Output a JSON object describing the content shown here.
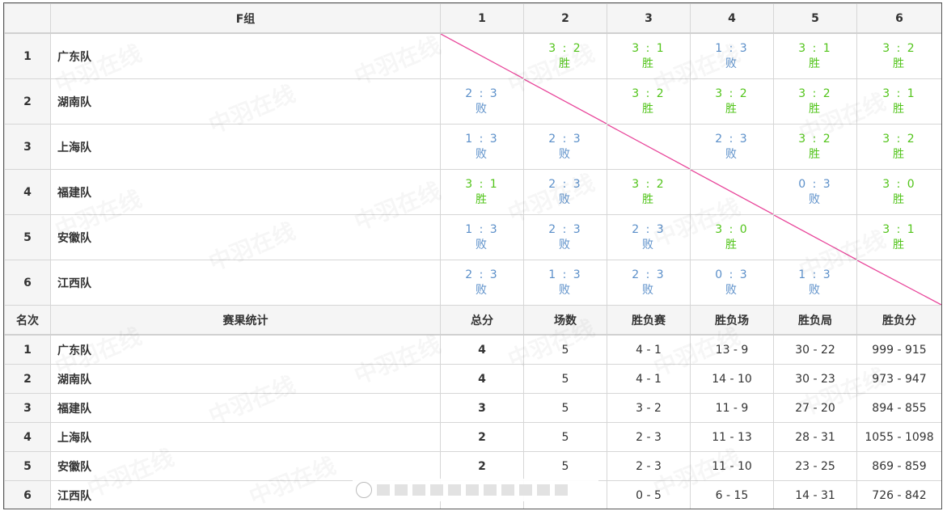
{
  "group_title": "F组",
  "columns": [
    "1",
    "2",
    "3",
    "4",
    "5",
    "6"
  ],
  "matrix": [
    {
      "rank": "1",
      "team": "广东队",
      "cells": [
        null,
        {
          "score": "3 : 2",
          "result": "胜",
          "win": true
        },
        {
          "score": "3 : 1",
          "result": "胜",
          "win": true
        },
        {
          "score": "1 : 3",
          "result": "败",
          "win": false
        },
        {
          "score": "3 : 1",
          "result": "胜",
          "win": true
        },
        {
          "score": "3 : 2",
          "result": "胜",
          "win": true
        }
      ]
    },
    {
      "rank": "2",
      "team": "湖南队",
      "cells": [
        {
          "score": "2 : 3",
          "result": "败",
          "win": false
        },
        null,
        {
          "score": "3 : 2",
          "result": "胜",
          "win": true
        },
        {
          "score": "3 : 2",
          "result": "胜",
          "win": true
        },
        {
          "score": "3 : 2",
          "result": "胜",
          "win": true
        },
        {
          "score": "3 : 1",
          "result": "胜",
          "win": true
        }
      ]
    },
    {
      "rank": "3",
      "team": "上海队",
      "cells": [
        {
          "score": "1 : 3",
          "result": "败",
          "win": false
        },
        {
          "score": "2 : 3",
          "result": "败",
          "win": false
        },
        null,
        {
          "score": "2 : 3",
          "result": "败",
          "win": false
        },
        {
          "score": "3 : 2",
          "result": "胜",
          "win": true
        },
        {
          "score": "3 : 2",
          "result": "胜",
          "win": true
        }
      ]
    },
    {
      "rank": "4",
      "team": "福建队",
      "cells": [
        {
          "score": "3 : 1",
          "result": "胜",
          "win": true
        },
        {
          "score": "2 : 3",
          "result": "败",
          "win": false
        },
        {
          "score": "3 : 2",
          "result": "胜",
          "win": true
        },
        null,
        {
          "score": "0 : 3",
          "result": "败",
          "win": false
        },
        {
          "score": "3 : 0",
          "result": "胜",
          "win": true
        }
      ]
    },
    {
      "rank": "5",
      "team": "安徽队",
      "cells": [
        {
          "score": "1 : 3",
          "result": "败",
          "win": false
        },
        {
          "score": "2 : 3",
          "result": "败",
          "win": false
        },
        {
          "score": "2 : 3",
          "result": "败",
          "win": false
        },
        {
          "score": "3 : 0",
          "result": "胜",
          "win": true
        },
        null,
        {
          "score": "3 : 1",
          "result": "胜",
          "win": true
        }
      ]
    },
    {
      "rank": "6",
      "team": "江西队",
      "cells": [
        {
          "score": "2 : 3",
          "result": "败",
          "win": false
        },
        {
          "score": "1 : 3",
          "result": "败",
          "win": false
        },
        {
          "score": "2 : 3",
          "result": "败",
          "win": false
        },
        {
          "score": "0 : 3",
          "result": "败",
          "win": false
        },
        {
          "score": "1 : 3",
          "result": "败",
          "win": false
        },
        null
      ]
    }
  ],
  "stats_header": [
    "名次",
    "赛果统计",
    "总分",
    "场数",
    "胜负赛",
    "胜负场",
    "胜负局",
    "胜负分"
  ],
  "stats": [
    [
      "1",
      "广东队",
      "4",
      "5",
      "4 - 1",
      "13 - 9",
      "30 - 22",
      "999 - 915"
    ],
    [
      "2",
      "湖南队",
      "4",
      "5",
      "4 - 1",
      "14 - 10",
      "30 - 23",
      "973 - 947"
    ],
    [
      "3",
      "福建队",
      "3",
      "5",
      "3 - 2",
      "11 - 9",
      "27 - 20",
      "894 - 855"
    ],
    [
      "4",
      "上海队",
      "2",
      "5",
      "2 - 3",
      "11 - 13",
      "28 - 31",
      "1055 - 1098"
    ],
    [
      "5",
      "安徽队",
      "2",
      "5",
      "2 - 3",
      "11 - 10",
      "23 - 25",
      "869 - 859"
    ],
    [
      "6",
      "江西队",
      "",
      "",
      "0 - 5",
      "6 - 15",
      "14 - 31",
      "726 - 842"
    ]
  ],
  "colors": {
    "win": "#52c41a",
    "lose": "#5b8fc9",
    "diagonal": "#e8459a"
  },
  "watermark_text": "中羽在线"
}
